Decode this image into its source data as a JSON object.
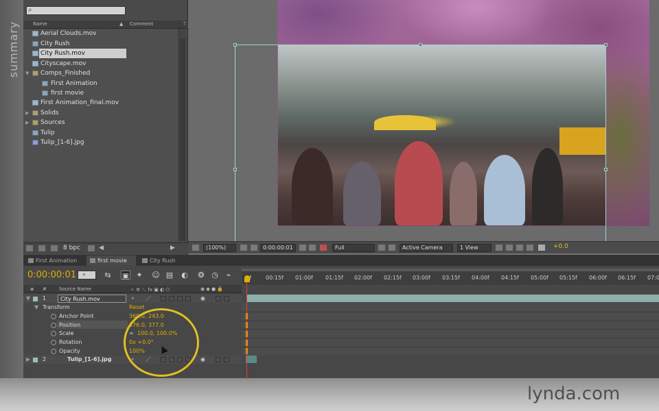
{
  "side_label": "summary",
  "project": {
    "search_placeholder": "",
    "columns": [
      "Name",
      "Comment"
    ],
    "items": [
      {
        "label": "Aerial Clouds.mov",
        "type": "file",
        "indent": 0
      },
      {
        "label": "City Rush",
        "type": "comp",
        "indent": 0
      },
      {
        "label": "City Rush.mov",
        "type": "file",
        "indent": 0,
        "selected": true
      },
      {
        "label": "Cityscape.mov",
        "type": "file",
        "indent": 0
      },
      {
        "label": "Comps_Finished",
        "type": "folder",
        "indent": 0,
        "expanded": true
      },
      {
        "label": "First Animation",
        "type": "comp",
        "indent": 1
      },
      {
        "label": "first movie",
        "type": "comp",
        "indent": 1
      },
      {
        "label": "First Animation_final.mov",
        "type": "file",
        "indent": 0
      },
      {
        "label": "Solids",
        "type": "folder",
        "indent": 0
      },
      {
        "label": "Sources",
        "type": "folder",
        "indent": 0
      },
      {
        "label": "Tulip",
        "type": "comp",
        "indent": 0
      },
      {
        "label": "Tulip_[1-6].jpg",
        "type": "img",
        "indent": 0
      }
    ],
    "footer_bpc": "8 bpc"
  },
  "viewer": {
    "zoom": "(100%)",
    "timecode": "0:00:00:01",
    "resolution": "Full",
    "camera": "Active Camera",
    "view": "1 View",
    "exposure": "+0.0"
  },
  "tabs": [
    {
      "label": "First Animation",
      "active": false
    },
    {
      "label": "first movie",
      "active": true
    },
    {
      "label": "City Rush",
      "active": false
    }
  ],
  "timeline": {
    "current_time": "0:00:00:01",
    "ruler_labels": [
      "0f",
      "00:15f",
      "01:00f",
      "01:15f",
      "02:00f",
      "02:15f",
      "03:00f",
      "03:15f",
      "04:00f",
      "04:15f",
      "05:00f",
      "05:15f",
      "06:00f",
      "06:15f",
      "07:0"
    ],
    "header_source_name": "Source Name",
    "layers": [
      {
        "index": "1",
        "name": "City Rush.mov"
      },
      {
        "index": "2",
        "name": "Tulip_[1-6].jpg"
      }
    ],
    "transform_label": "Transform",
    "reset_label": "Reset",
    "properties": [
      {
        "name": "Anchor Point",
        "value": "360.0, 243.0"
      },
      {
        "name": "Position",
        "value": "376.0, 377.0"
      },
      {
        "name": "Scale",
        "value": "100.0, 100.0%"
      },
      {
        "name": "Rotation",
        "value": "0x +0.0°"
      },
      {
        "name": "Opacity",
        "value": "100%"
      }
    ]
  },
  "watermark": "lynda.com",
  "colors": {
    "accent": "#e0b000",
    "highlight_circle": "#e0c020",
    "selection": "#9fd2d2"
  }
}
